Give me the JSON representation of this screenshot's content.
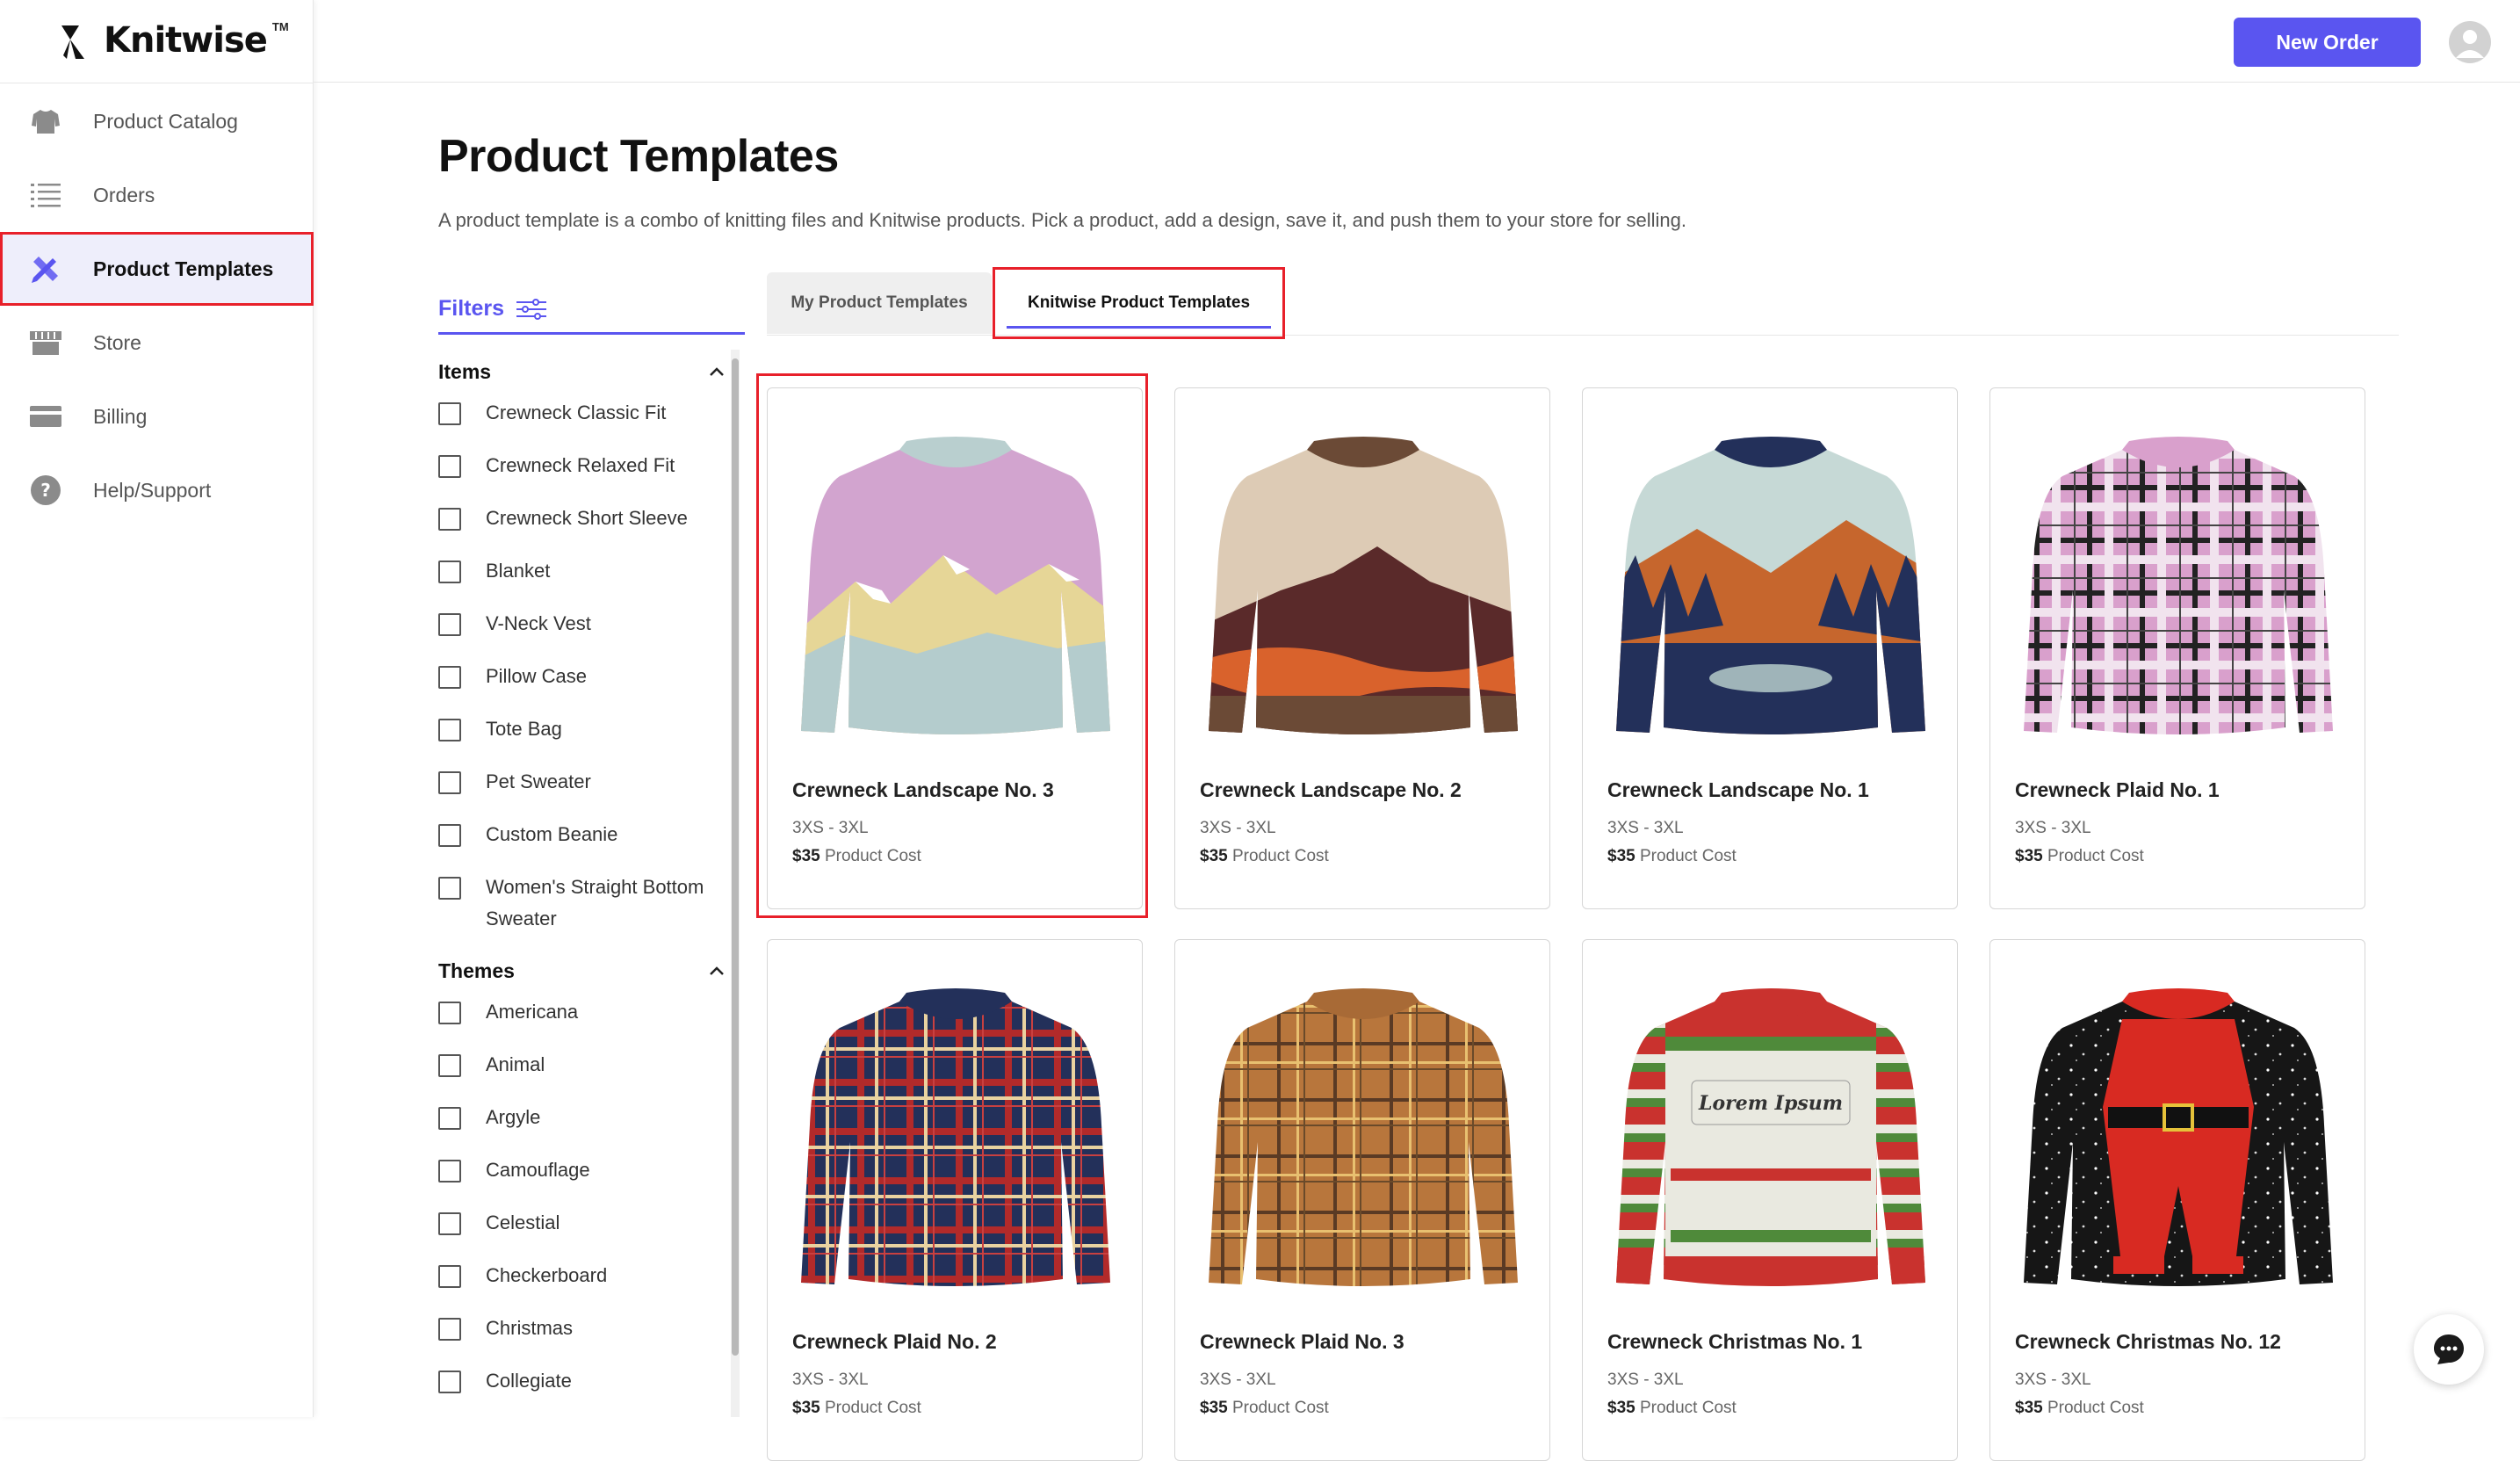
{
  "brand": {
    "name": "Knitwise",
    "tm": "TM"
  },
  "sidebar": {
    "items": [
      {
        "label": "Product Catalog",
        "icon": "sweater-icon"
      },
      {
        "label": "Orders",
        "icon": "list-icon"
      },
      {
        "label": "Product Templates",
        "icon": "ruler-pencil-icon",
        "active": true
      },
      {
        "label": "Store",
        "icon": "storefront-icon"
      },
      {
        "label": "Billing",
        "icon": "card-icon"
      },
      {
        "label": "Help/Support",
        "icon": "help-circle-icon"
      }
    ]
  },
  "header": {
    "new_order_label": "New Order",
    "avatar_icon": "user-avatar-icon"
  },
  "main": {
    "title": "Product Templates",
    "description": "A product template is a combo of knitting files and Knitwise products. Pick a product, add a design, save it, and push them to your store for selling.",
    "tabs": [
      {
        "label": "My Product Templates",
        "active": false
      },
      {
        "label": "Knitwise Product Templates",
        "active": true
      }
    ]
  },
  "filters": {
    "title": "Filters",
    "groups": [
      {
        "title": "Items",
        "options": [
          "Crewneck Classic Fit",
          "Crewneck Relaxed Fit",
          "Crewneck Short Sleeve",
          "Blanket",
          "V-Neck Vest",
          "Pillow Case",
          "Tote Bag",
          "Pet Sweater",
          "Custom Beanie",
          "Women's Straight Bottom Sweater"
        ]
      },
      {
        "title": "Themes",
        "options": [
          "Americana",
          "Animal",
          "Argyle",
          "Camouflage",
          "Celestial",
          "Checkerboard",
          "Christmas",
          "Collegiate"
        ]
      }
    ]
  },
  "products": [
    {
      "name": "Crewneck Landscape No. 3",
      "sizes": "3XS - 3XL",
      "price": "$35",
      "cost_label": "Product Cost"
    },
    {
      "name": "Crewneck Landscape No. 2",
      "sizes": "3XS - 3XL",
      "price": "$35",
      "cost_label": "Product Cost"
    },
    {
      "name": "Crewneck Landscape No. 1",
      "sizes": "3XS - 3XL",
      "price": "$35",
      "cost_label": "Product Cost"
    },
    {
      "name": "Crewneck Plaid No. 1",
      "sizes": "3XS - 3XL",
      "price": "$35",
      "cost_label": "Product Cost"
    },
    {
      "name": "Crewneck Plaid No. 2",
      "sizes": "3XS - 3XL",
      "price": "$35",
      "cost_label": "Product Cost"
    },
    {
      "name": "Crewneck Plaid No. 3",
      "sizes": "3XS - 3XL",
      "price": "$35",
      "cost_label": "Product Cost"
    },
    {
      "name": "Crewneck Christmas No. 1",
      "sizes": "3XS - 3XL",
      "price": "$35",
      "cost_label": "Product Cost",
      "print_text": "Lorem Ipsum"
    },
    {
      "name": "Crewneck Christmas No. 12",
      "sizes": "3XS - 3XL",
      "price": "$35",
      "cost_label": "Product Cost"
    }
  ],
  "colors": {
    "accent": "#5a55f0",
    "highlight": "#e8202a"
  }
}
